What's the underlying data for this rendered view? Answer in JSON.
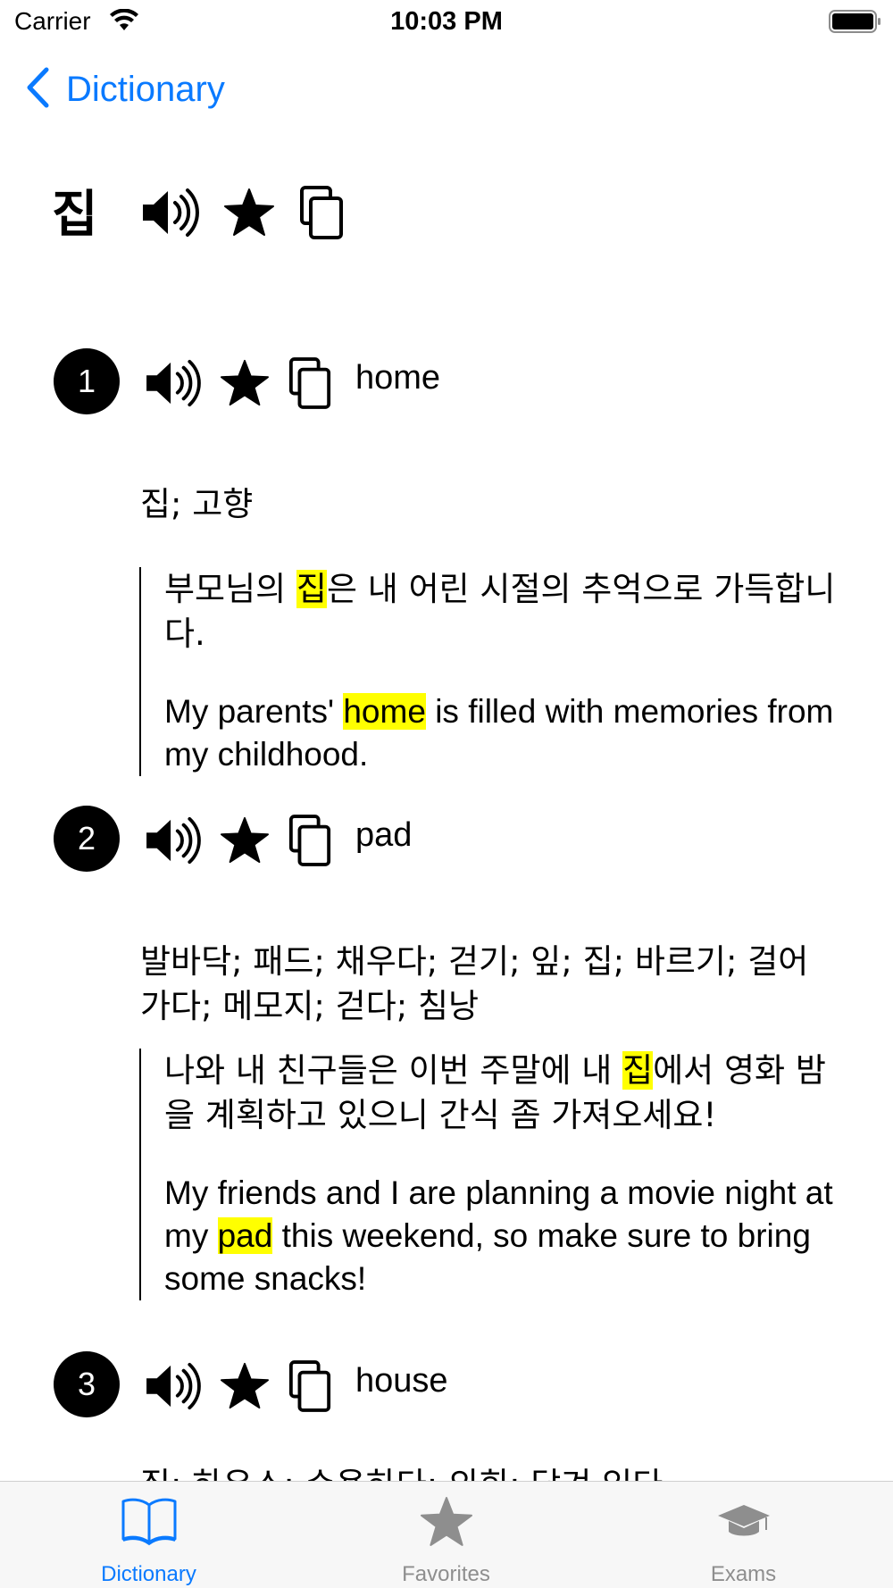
{
  "status_bar": {
    "carrier": "Carrier",
    "time": "10:03 PM"
  },
  "nav": {
    "back_label": "Dictionary"
  },
  "entry": {
    "headword": "집",
    "senses": [
      {
        "number": "1",
        "gloss": "home",
        "definitions": "집; 고향",
        "example_ko": {
          "before": "부모님의 ",
          "highlight": "집",
          "after": "은 내 어린 시절의 추억으로 가득합니다."
        },
        "example_en": {
          "before": "My parents' ",
          "highlight": "home",
          "after": " is filled with memories from my childhood."
        }
      },
      {
        "number": "2",
        "gloss": "pad",
        "definitions": "발바닥; 패드; 채우다; 걷기; 잎; 집; 바르기; 걸어가다; 메모지; 걷다; 침낭",
        "example_ko": {
          "before": "나와 내 친구들은 이번 주말에 내 ",
          "highlight": "집",
          "after": "에서 영화 밤을 계획하고 있으니 간식 좀 가져오세요!"
        },
        "example_en": {
          "before": "My friends and I are planning a movie night at my ",
          "highlight": "pad",
          "after": " this weekend, so make sure to bring some snacks!"
        }
      },
      {
        "number": "3",
        "gloss": "house",
        "definitions": "집; 하우스; 수용하다; 의회; 닫겨 있다"
      }
    ]
  },
  "tabs": [
    {
      "label": "Dictionary",
      "icon": "book-icon",
      "active": true
    },
    {
      "label": "Favorites",
      "icon": "star-icon",
      "active": false
    },
    {
      "label": "Exams",
      "icon": "graduation-cap-icon",
      "active": false
    }
  ],
  "colors": {
    "accent": "#0a7aff",
    "highlight": "#ffff00",
    "tab_inactive": "#8e8e8e"
  }
}
